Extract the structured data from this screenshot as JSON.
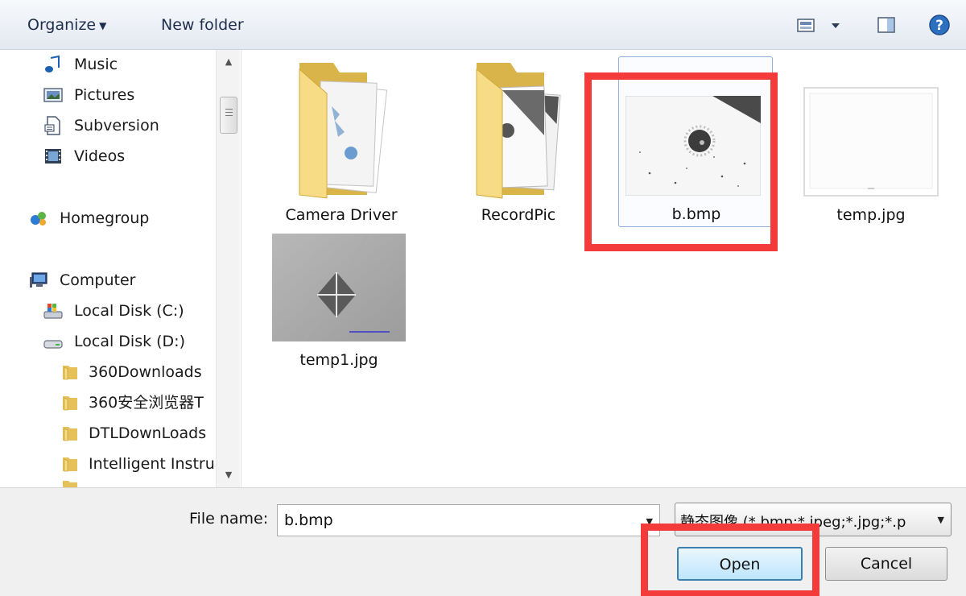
{
  "toolbar": {
    "organize_label": "Organize",
    "new_folder_label": "New folder",
    "icons": [
      "change-view-icon",
      "view-dropdown-icon",
      "preview-pane-icon",
      "help-icon"
    ]
  },
  "nav": {
    "items": [
      {
        "label": "Music",
        "icon": "music-icon"
      },
      {
        "label": "Pictures",
        "icon": "pictures-icon"
      },
      {
        "label": "Subversion",
        "icon": "document-icon"
      },
      {
        "label": "Videos",
        "icon": "videos-icon"
      },
      {
        "label": "Homegroup",
        "icon": "homegroup-icon"
      },
      {
        "label": "Computer",
        "icon": "computer-icon"
      },
      {
        "label": "Local Disk (C:)",
        "icon": "system-drive-icon"
      },
      {
        "label": "Local Disk (D:)",
        "icon": "drive-icon"
      },
      {
        "label": "360Downloads",
        "icon": "folder-icon"
      },
      {
        "label": "360安全浏览器T",
        "icon": "folder-icon"
      },
      {
        "label": "DTLDownLoads",
        "icon": "folder-icon"
      },
      {
        "label": "Intelligent Instru",
        "icon": "folder-icon"
      }
    ]
  },
  "files": [
    {
      "name": "Camera Driver",
      "type": "folder"
    },
    {
      "name": "RecordPic",
      "type": "folder"
    },
    {
      "name": "b.bmp",
      "type": "image",
      "selected": true
    },
    {
      "name": "temp.jpg",
      "type": "image"
    },
    {
      "name": "temp1.jpg",
      "type": "image"
    }
  ],
  "bottom": {
    "file_name_label": "File name:",
    "file_name_value": "b.bmp",
    "file_type_value": "静态图像 (*.bmp;*.jpeg;*.jpg;*.p",
    "open_label": "Open",
    "cancel_label": "Cancel"
  },
  "colors": {
    "highlight_box": "#f43b3b",
    "selection": "#8fb3d8",
    "open_border": "#3c7fb1"
  }
}
